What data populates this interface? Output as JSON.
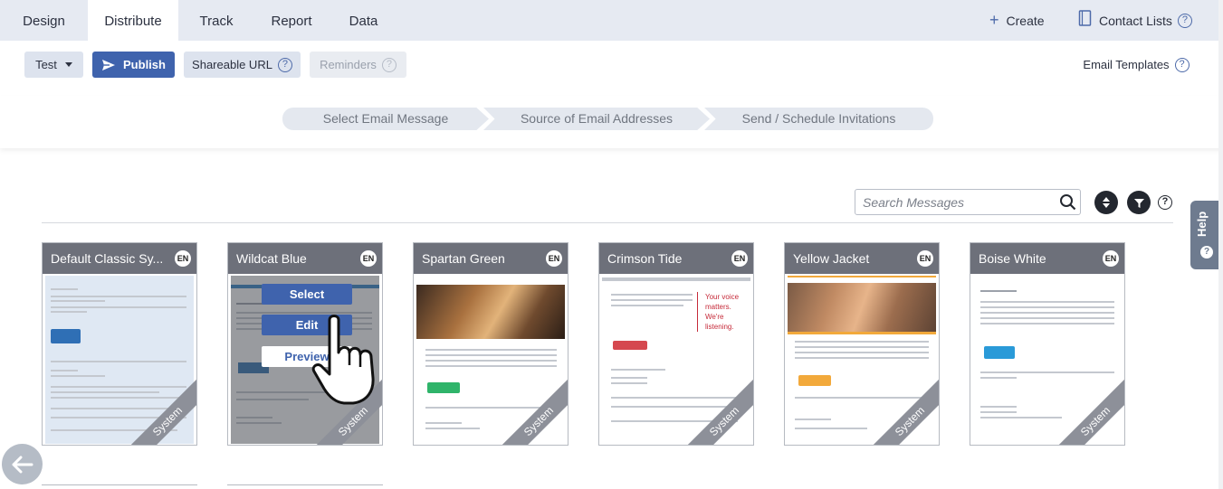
{
  "nav": {
    "tabs": [
      "Design",
      "Distribute",
      "Track",
      "Report",
      "Data"
    ],
    "active_tab": "Distribute",
    "create_label": "Create",
    "contact_lists_label": "Contact Lists"
  },
  "toolbar": {
    "test_label": "Test",
    "publish_label": "Publish",
    "shareable_url_label": "Shareable URL",
    "reminders_label": "Reminders",
    "email_templates_label": "Email Templates"
  },
  "steps": [
    "Select Email Message",
    "Source of Email Addresses",
    "Send / Schedule Invitations"
  ],
  "search": {
    "placeholder": "Search Messages"
  },
  "cards": [
    {
      "title": "Default Classic Sy...",
      "lang": "EN",
      "badge": "System"
    },
    {
      "title": "Wildcat Blue",
      "lang": "EN",
      "badge": "System"
    },
    {
      "title": "Spartan Green",
      "lang": "EN",
      "badge": "System"
    },
    {
      "title": "Crimson Tide",
      "lang": "EN",
      "badge": "System"
    },
    {
      "title": "Yellow Jacket",
      "lang": "EN",
      "badge": "System"
    },
    {
      "title": "Boise White",
      "lang": "EN",
      "badge": "System"
    }
  ],
  "hover_actions": {
    "select": "Select",
    "edit": "Edit",
    "preview": "Preview"
  },
  "crimson_quote": "Your voice matters. We're listening.",
  "help_label": "Help",
  "colors": {
    "primary": "#3f63ad",
    "card_header": "#6d707a",
    "nav_bg": "#e6eaf2"
  }
}
